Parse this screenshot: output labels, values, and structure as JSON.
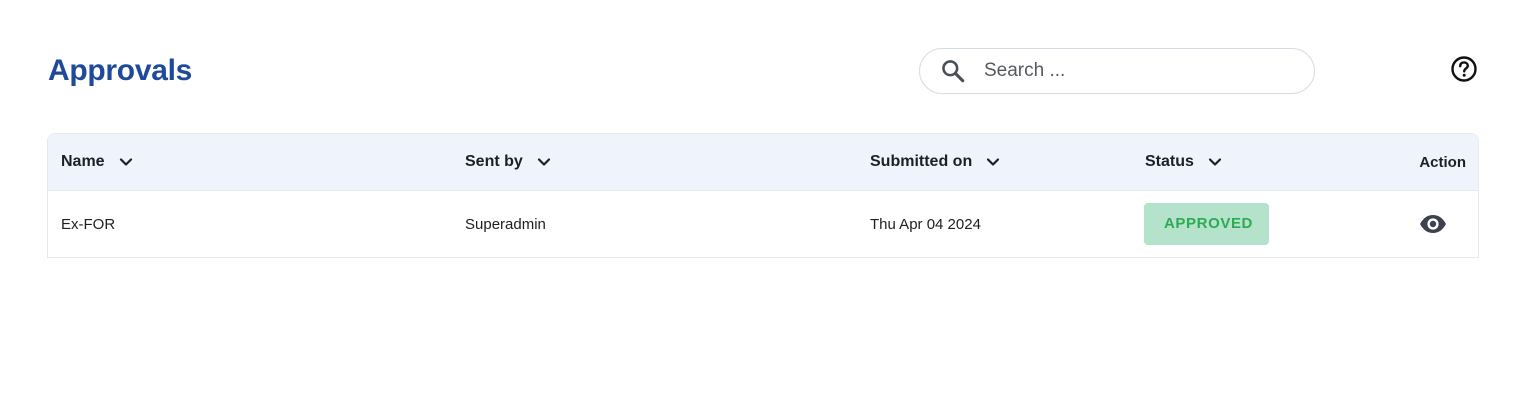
{
  "header": {
    "title": "Approvals",
    "search_placeholder": "Search ...",
    "search_value": ""
  },
  "icons": {
    "search": "search-icon",
    "help": "help-circle-icon",
    "sort": "chevron-down-icon",
    "view": "eye-icon"
  },
  "table": {
    "columns": [
      {
        "label": "Name",
        "sortable": true
      },
      {
        "label": "Sent by",
        "sortable": true
      },
      {
        "label": "Submitted on",
        "sortable": true
      },
      {
        "label": "Status",
        "sortable": true
      },
      {
        "label": "Action",
        "sortable": false
      }
    ],
    "rows": [
      {
        "name": "Ex-FOR",
        "sent_by": "Superadmin",
        "submitted_on": "Thu Apr 04 2024",
        "status": "APPROVED"
      }
    ]
  },
  "colors": {
    "title": "#1f4a9c",
    "header_bg": "#eff3fc",
    "status_approved_bg": "#b5e2ca",
    "status_approved_text": "#2eaa55",
    "eye_icon": "#3d4250"
  }
}
